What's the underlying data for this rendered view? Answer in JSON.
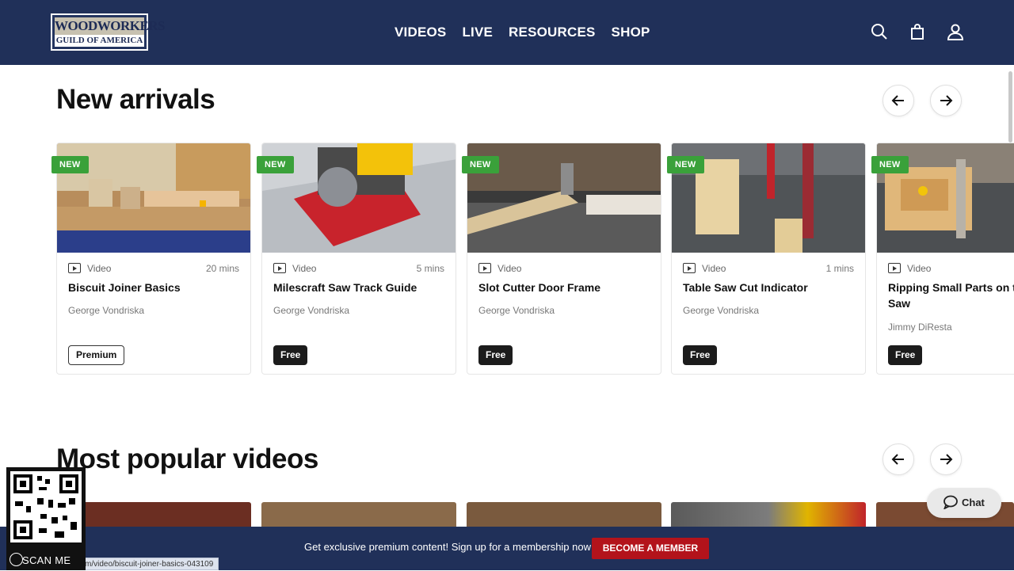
{
  "header": {
    "logo_line1": "WOODWORKERS",
    "logo_line2": "GUILD OF AMERICA",
    "nav": [
      "VIDEOS",
      "LIVE",
      "RESOURCES",
      "SHOP"
    ],
    "icons": [
      "search-icon",
      "cart-icon",
      "user-icon"
    ]
  },
  "new_arrivals": {
    "title": "New arrivals",
    "cards": [
      {
        "badge": "NEW",
        "type": "Video",
        "duration": "20 mins",
        "title": "Biscuit Joiner Basics",
        "author": "George Vondriska",
        "access": "Premium"
      },
      {
        "badge": "NEW",
        "type": "Video",
        "duration": "5 mins",
        "title": "Milescraft Saw Track Guide",
        "author": "George Vondriska",
        "access": "Free"
      },
      {
        "badge": "NEW",
        "type": "Video",
        "duration": "",
        "title": "Slot Cutter Door Frame",
        "author": "George Vondriska",
        "access": "Free"
      },
      {
        "badge": "NEW",
        "type": "Video",
        "duration": "1 mins",
        "title": "Table Saw Cut Indicator",
        "author": "George Vondriska",
        "access": "Free"
      },
      {
        "badge": "NEW",
        "type": "Video",
        "duration": "",
        "title": "Ripping Small Parts on the Table Saw",
        "author": "Jimmy DiResta",
        "access": "Free"
      }
    ]
  },
  "most_popular": {
    "title": "Most popular videos"
  },
  "chat": {
    "label": "Chat"
  },
  "promo": {
    "text": "Get exclusive premium content! Sign up for a membership now!",
    "button": "BECOME A MEMBER"
  },
  "qr": {
    "label": "SCAN ME"
  },
  "status_url": "m/video/biscuit-joiner-basics-043109",
  "colors": {
    "navy": "#203059",
    "new_badge": "#3aa13a",
    "member_red": "#b3131b"
  }
}
